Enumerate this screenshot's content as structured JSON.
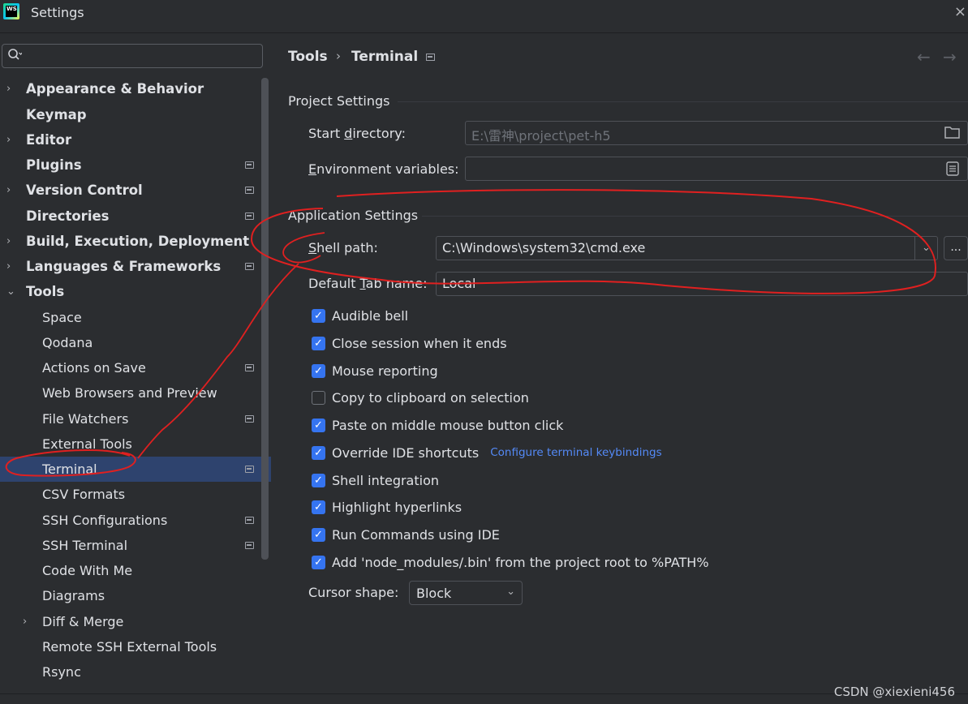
{
  "window": {
    "title": "Settings",
    "app_logo_text": "WS",
    "close_icon": "×"
  },
  "search": {
    "placeholder": "",
    "icon": "Q"
  },
  "sidebar": {
    "items": [
      {
        "label": "Appearance & Behavior",
        "level": 0,
        "arrow": "›",
        "badge": false
      },
      {
        "label": "Keymap",
        "level": 0,
        "arrow": "",
        "badge": false
      },
      {
        "label": "Editor",
        "level": 0,
        "arrow": "›",
        "badge": false
      },
      {
        "label": "Plugins",
        "level": 0,
        "arrow": "",
        "badge": true
      },
      {
        "label": "Version Control",
        "level": 0,
        "arrow": "›",
        "badge": true
      },
      {
        "label": "Directories",
        "level": 0,
        "arrow": "",
        "badge": true
      },
      {
        "label": "Build, Execution, Deployment",
        "level": 0,
        "arrow": "›",
        "badge": false
      },
      {
        "label": "Languages & Frameworks",
        "level": 0,
        "arrow": "›",
        "badge": true
      },
      {
        "label": "Tools",
        "level": 0,
        "arrow": "⌄",
        "badge": false
      },
      {
        "label": "Space",
        "level": 1,
        "arrow": "",
        "badge": false
      },
      {
        "label": "Qodana",
        "level": 1,
        "arrow": "",
        "badge": false
      },
      {
        "label": "Actions on Save",
        "level": 1,
        "arrow": "",
        "badge": true
      },
      {
        "label": "Web Browsers and Preview",
        "level": 1,
        "arrow": "",
        "badge": false
      },
      {
        "label": "File Watchers",
        "level": 1,
        "arrow": "",
        "badge": true
      },
      {
        "label": "External Tools",
        "level": 1,
        "arrow": "",
        "badge": false
      },
      {
        "label": "Terminal",
        "level": 1,
        "arrow": "",
        "badge": true,
        "selected": true
      },
      {
        "label": "CSV Formats",
        "level": 1,
        "arrow": "",
        "badge": false
      },
      {
        "label": "SSH Configurations",
        "level": 1,
        "arrow": "",
        "badge": true
      },
      {
        "label": "SSH Terminal",
        "level": 1,
        "arrow": "",
        "badge": true
      },
      {
        "label": "Code With Me",
        "level": 1,
        "arrow": "",
        "badge": false
      },
      {
        "label": "Diagrams",
        "level": 1,
        "arrow": "",
        "badge": false
      },
      {
        "label": "Diff & Merge",
        "level": 1,
        "arrow": "›",
        "badge": false
      },
      {
        "label": "Remote SSH External Tools",
        "level": 1,
        "arrow": "",
        "badge": false
      },
      {
        "label": "Rsync",
        "level": 1,
        "arrow": "",
        "badge": false
      }
    ]
  },
  "breadcrumb": {
    "parent": "Tools",
    "separator": "›",
    "current": "Terminal",
    "back_icon": "←",
    "forward_icon": "→"
  },
  "project_settings": {
    "heading": "Project Settings",
    "start_directory": {
      "label_pre": "Start ",
      "label_u": "d",
      "label_post": "irectory:",
      "value": "E:\\雷神\\project\\pet-h5"
    },
    "env_vars": {
      "label_u": "E",
      "label_post": "nvironment variables:",
      "value": ""
    }
  },
  "application_settings": {
    "heading": "Application Settings",
    "shell_path": {
      "label_u": "S",
      "label_post": "hell path:",
      "value": "C:\\Windows\\system32\\cmd.exe",
      "dropdown_icon": "⌄",
      "browse_label": "..."
    },
    "tab_name": {
      "label_pre": "Default ",
      "label_u": "T",
      "label_post": "ab name:",
      "value": "Local"
    }
  },
  "checkboxes": [
    {
      "label": "Audible bell",
      "checked": true
    },
    {
      "label": "Close session when it ends",
      "checked": true
    },
    {
      "label": "Mouse reporting",
      "checked": true
    },
    {
      "label": "Copy to clipboard on selection",
      "checked": false
    },
    {
      "label": "Paste on middle mouse button click",
      "checked": true
    },
    {
      "label": "Override IDE shortcuts",
      "checked": true,
      "link": "Configure terminal keybindings"
    },
    {
      "label": "Shell integration",
      "checked": true
    },
    {
      "label": "Highlight hyperlinks",
      "checked": true
    },
    {
      "label": "Run Commands using IDE",
      "checked": true
    },
    {
      "label": "Add 'node_modules/.bin' from the project root to %PATH%",
      "checked": true
    }
  ],
  "cursor_shape": {
    "label": "Cursor shape:",
    "value": "Block",
    "arrow": "⌄"
  },
  "watermark": "CSDN @xiexieni456",
  "colors": {
    "accent": "#3574f0",
    "selection": "#2e436e",
    "link": "#548af7",
    "annotation": "#e02020"
  }
}
